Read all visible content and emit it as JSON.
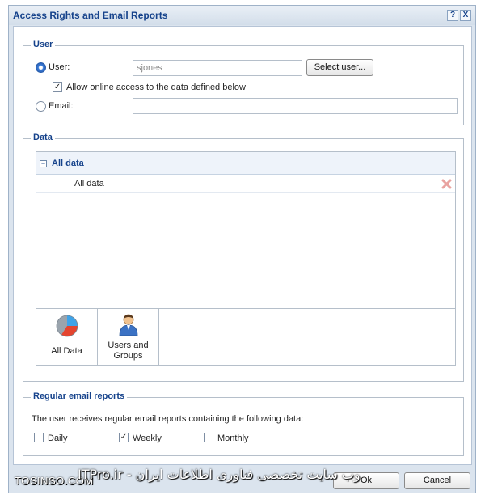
{
  "dialog": {
    "title": "Access Rights and Email Reports",
    "help_button": "?",
    "close_button": "X"
  },
  "user_group": {
    "legend": "User",
    "user_option_label": "User:",
    "user_selected": true,
    "user_value": "sjones",
    "select_user_button": "Select user...",
    "allow_online_label": "Allow online access to the data defined below",
    "allow_online_checked": true,
    "email_option_label": "Email:",
    "email_value": ""
  },
  "data_group": {
    "legend": "Data",
    "header_title": "All data",
    "collapse_icon": "minus-box-icon",
    "rows": [
      {
        "label": "All data",
        "delete_icon": "red-x-icon"
      }
    ],
    "tiles": [
      {
        "label": "All Data",
        "icon": "pie-chart-icon"
      },
      {
        "label_line1": "Users and",
        "label_line2": "Groups",
        "icon": "user-icon"
      }
    ]
  },
  "email_group": {
    "legend": "Regular email reports",
    "description": "The user receives regular email reports containing the following data:",
    "options": [
      {
        "label": "Daily",
        "checked": false
      },
      {
        "label": "Weekly",
        "checked": true
      },
      {
        "label": "Monthly",
        "checked": false
      }
    ]
  },
  "footer": {
    "ok_button": "Ok",
    "cancel_button": "Cancel"
  },
  "watermarks": {
    "left": "TOSINSO.COM",
    "right": "ITPro.ir - وب سایت تخصصی فناوری اطلاعات ایران"
  },
  "colors": {
    "title_blue": "#15428b",
    "dialog_bg": "#dbe4ee",
    "accent": "#2b63b8",
    "delete_red": "#e0413a"
  }
}
